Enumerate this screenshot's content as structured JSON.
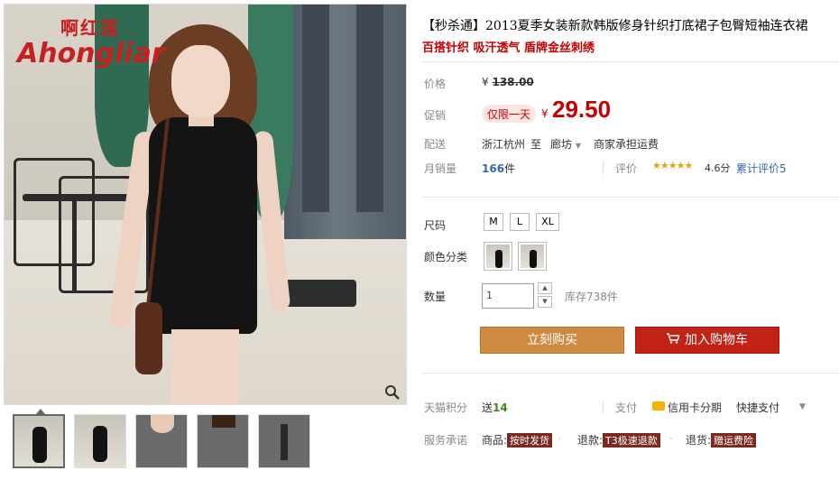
{
  "brand": {
    "cn": "啊红莲",
    "en": "Ahongliar"
  },
  "product": {
    "title": "【秒杀通】2013夏季女装新款韩版修身针织打底裙子包臀短袖连衣裙",
    "subtitle": "百搭针织 吸汗透气 盾牌金丝刺绣"
  },
  "price": {
    "label": "价格",
    "currency": "¥",
    "original": "138.00",
    "promo_label": "促销",
    "promo_tag": "仅限一天",
    "promo_price": "29.50"
  },
  "shipping": {
    "label": "配送",
    "from": "浙江杭州",
    "to_word": "至",
    "dest": "廊坊",
    "fee_note": "商家承担运费"
  },
  "sales": {
    "label": "月销量",
    "count": "166",
    "unit": "件",
    "rating_label": "评价",
    "stars": "★★★★★",
    "score": "4.6分",
    "reviews": "累计评价5"
  },
  "size": {
    "label": "尺码",
    "options": [
      "M",
      "L",
      "XL"
    ]
  },
  "color": {
    "label": "颜色分类"
  },
  "quantity": {
    "label": "数量",
    "value": "1",
    "stock": "库存738件"
  },
  "actions": {
    "buy": "立刻购买",
    "cart": "加入购物车"
  },
  "points": {
    "label": "天猫积分",
    "prefix": "送",
    "value": "14"
  },
  "payment": {
    "label": "支付",
    "card": "信用卡分期",
    "quick": "快捷支付"
  },
  "service": {
    "label": "服务承诺",
    "item1_prefix": "商品:",
    "item1_badge": "按时发货",
    "item2_prefix": "退款:",
    "item2_badge": "T3极速退款",
    "item3_prefix": "退货:",
    "item3_badge": "赠运费险"
  },
  "icons": {
    "zoom": "magnifier-icon",
    "cart": "cart-icon",
    "card": "credit-card-icon",
    "dropdown": "chevron-down-icon"
  },
  "colors": {
    "accent": "#c40000",
    "buy": "#cf8a42",
    "cart": "#c22316",
    "rating": "#e2a218"
  }
}
